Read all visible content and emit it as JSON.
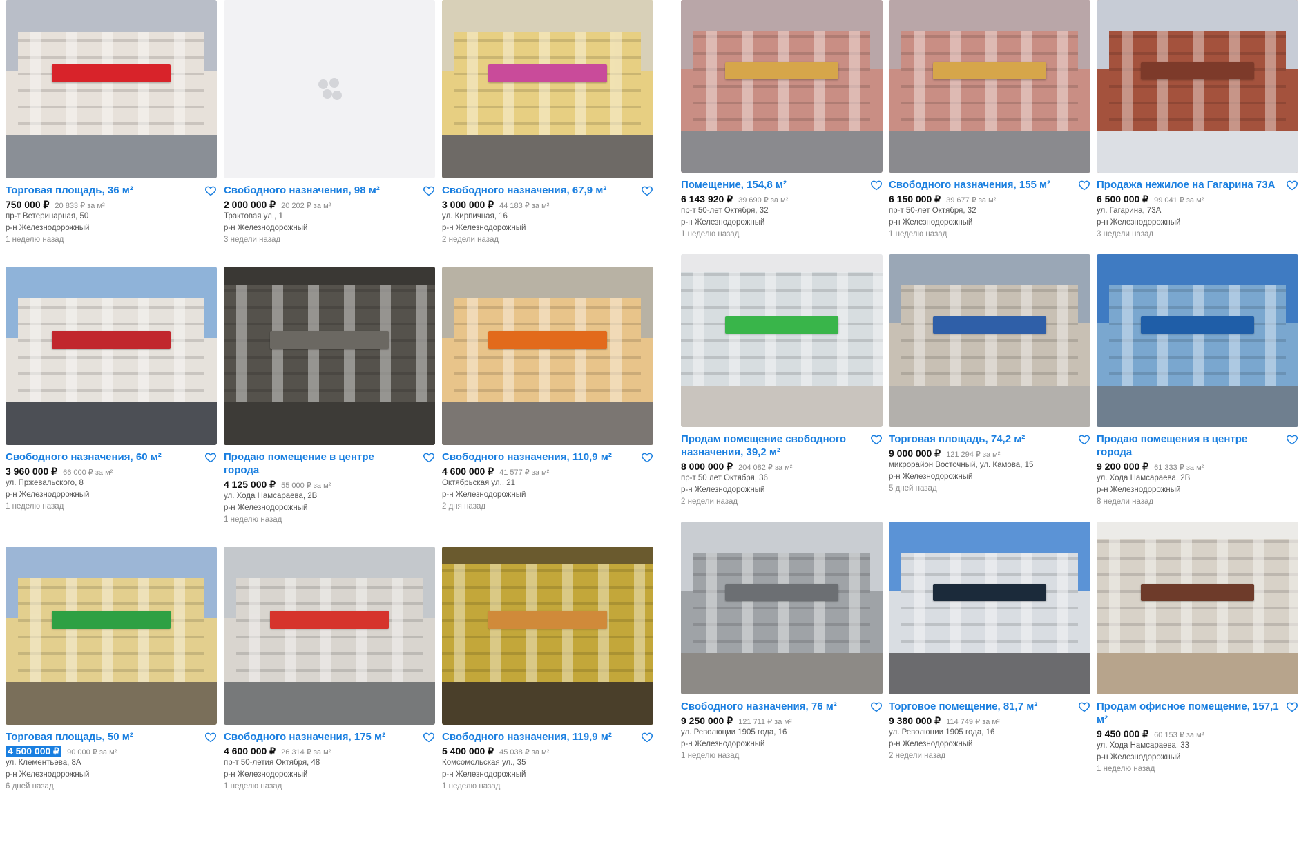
{
  "left": {
    "cards": [
      {
        "title": "Торговая площадь, 36 м²",
        "price": "750 000 ₽",
        "ppm": "20 833 ₽ за м²",
        "address": "пр-т Ветеринарная, 50",
        "district": "р-н Железнодорожный",
        "date": "1 неделю назад",
        "photo": {
          "type": "street",
          "sky": "#b9bec8",
          "wall": "#e7e1da",
          "sign": "#d8232a",
          "ground": "#8a8f96"
        }
      },
      {
        "title": "Свободного назначения, 98 м²",
        "price": "2 000 000 ₽",
        "ppm": "20 202 ₽ за м²",
        "address": "Трактовая ул., 1",
        "district": "р-н Железнодорожный",
        "date": "3 недели назад",
        "photo": {
          "type": "placeholder"
        }
      },
      {
        "title": "Свободного назначения, 67,9 м²",
        "price": "3 000 000 ₽",
        "ppm": "44 183 ₽ за м²",
        "address": "ул. Кирпичная, 16",
        "district": "р-н Железнодорожный",
        "date": "2 недели назад",
        "photo": {
          "type": "street",
          "sky": "#d8d0b8",
          "wall": "#e7cf82",
          "sign": "#c94b9a",
          "ground": "#6e6a66"
        }
      },
      {
        "title": "Свободного назначения, 60 м²",
        "price": "3 960 000 ₽",
        "ppm": "66 000 ₽ за м²",
        "address": "ул. Пржевальского, 8",
        "district": "р-н Железнодорожный",
        "date": "1 неделю назад",
        "photo": {
          "type": "street",
          "sky": "#8fb3d9",
          "wall": "#e6e2dc",
          "sign": "#c1272d",
          "ground": "#4c4f55"
        }
      },
      {
        "title": "Продаю помещение в центре города",
        "price": "4 125 000 ₽",
        "ppm": "55 000 ₽ за м²",
        "address": "ул. Хода Намсараева, 2В",
        "district": "р-н Железнодорожный",
        "date": "1 неделю назад",
        "photo": {
          "type": "interior",
          "sky": "#3a3834",
          "wall": "#55524c",
          "sign": "#6b6862",
          "ground": "#3d3b37"
        }
      },
      {
        "title": "Свободного назначения, 110,9 м²",
        "price": "4 600 000 ₽",
        "ppm": "41 577 ₽ за м²",
        "address": "Октябрьская ул., 21",
        "district": "р-н Железнодорожный",
        "date": "2 дня назад",
        "photo": {
          "type": "street",
          "sky": "#b8b2a4",
          "wall": "#e8c48a",
          "sign": "#e26a1b",
          "ground": "#7b7672"
        }
      },
      {
        "title": "Торговая площадь, 50 м²",
        "price": "4 500 000 ₽",
        "ppm": "90 000 ₽ за м²",
        "address": "ул. Клементьева, 8А",
        "district": "р-н Железнодорожный",
        "date": "6 дней назад",
        "highlight": true,
        "photo": {
          "type": "street",
          "sky": "#9cb6d6",
          "wall": "#e3cf8e",
          "sign": "#2ea043",
          "ground": "#7a6f5a"
        }
      },
      {
        "title": "Свободного назначения, 175 м²",
        "price": "4 600 000 ₽",
        "ppm": "26 314 ₽ за м²",
        "address": "пр-т 50-летия Октября, 48",
        "district": "р-н Железнодорожный",
        "date": "1 неделю назад",
        "photo": {
          "type": "street",
          "sky": "#c4c8cc",
          "wall": "#d9d5cf",
          "sign": "#d6342c",
          "ground": "#77797a"
        }
      },
      {
        "title": "Свободного назначения, 119,9 м²",
        "price": "5 400 000 ₽",
        "ppm": "45 038 ₽ за м²",
        "address": "Комсомольская ул., 35",
        "district": "р-н Железнодорожный",
        "date": "1 неделю назад",
        "photo": {
          "type": "interior",
          "sky": "#6a5a2e",
          "wall": "#c3a73a",
          "sign": "#d08a3a",
          "ground": "#4a3f2a"
        }
      }
    ]
  },
  "right": {
    "cards": [
      {
        "title": "Помещение, 154,8 м²",
        "price": "6 143 920 ₽",
        "ppm": "39 690 ₽ за м²",
        "address": "пр-т 50-лет Октября, 32",
        "district": "р-н Железнодорожный",
        "date": "1 неделю назад",
        "photo": {
          "type": "street",
          "sky": "#b9a6a8",
          "wall": "#c98e84",
          "sign": "#d6a64a",
          "ground": "#8a8a8e"
        }
      },
      {
        "title": "Свободного назначения, 155 м²",
        "price": "6 150 000 ₽",
        "ppm": "39 677 ₽ за м²",
        "address": "пр-т 50-лет Октября, 32",
        "district": "р-н Железнодорожный",
        "date": "1 неделю назад",
        "photo": {
          "type": "street",
          "sky": "#b9a6a8",
          "wall": "#c98e84",
          "sign": "#d6a64a",
          "ground": "#8a8a8e"
        }
      },
      {
        "title": "Продажа нежилое на Гагарина 73А",
        "price": "6 500 000 ₽",
        "ppm": "99 041 ₽ за м²",
        "address": "ул. Гагарина, 73А",
        "district": "р-н Железнодорожный",
        "date": "3 недели назад",
        "photo": {
          "type": "street",
          "sky": "#c7ccd6",
          "wall": "#a4523d",
          "sign": "#7d3a2a",
          "ground": "#dcdfe4"
        }
      },
      {
        "title": "Продам помещение свободного назначения, 39,2 м²",
        "price": "8 000 000 ₽",
        "ppm": "204 082 ₽ за м²",
        "address": "пр-т 50 лет Октября, 36",
        "district": "р-н Железнодорожный",
        "date": "2 недели назад",
        "photo": {
          "type": "interior",
          "sky": "#e8e8ea",
          "wall": "#d7dde0",
          "sign": "#39b54a",
          "ground": "#c9c4be"
        }
      },
      {
        "title": "Торговая площадь, 74,2 м²",
        "price": "9 000 000 ₽",
        "ppm": "121 294 ₽ за м²",
        "address": "микрорайон Восточный, ул. Камова, 15",
        "district": "р-н Железнодорожный",
        "date": "5 дней назад",
        "photo": {
          "type": "street",
          "sky": "#9aa7b6",
          "wall": "#c8c0b4",
          "sign": "#2f5fa8",
          "ground": "#b3b0ac"
        }
      },
      {
        "title": "Продаю помещения в центре города",
        "price": "9 200 000 ₽",
        "ppm": "61 333 ₽ за м²",
        "address": "ул. Хода Намсараева, 2В",
        "district": "р-н Железнодорожный",
        "date": "8 недели назад",
        "photo": {
          "type": "street",
          "sky": "#3f7bc2",
          "wall": "#7aa7cf",
          "sign": "#1f5ea8",
          "ground": "#6f7f8f"
        }
      },
      {
        "title": "Свободного назначения, 76 м²",
        "price": "9 250 000 ₽",
        "ppm": "121 711 ₽ за м²",
        "address": "ул. Революции 1905 года, 16",
        "district": "р-н Железнодорожный",
        "date": "1 неделю назад",
        "photo": {
          "type": "street",
          "sky": "#c9cdd2",
          "wall": "#9fa3a7",
          "sign": "#6c6f73",
          "ground": "#8d8a86"
        }
      },
      {
        "title": "Торговое помещение, 81,7 м²",
        "price": "9 380 000 ₽",
        "ppm": "114 749 ₽ за м²",
        "address": "ул. Революции 1905 года, 16",
        "district": "р-н Железнодорожный",
        "date": "2 недели назад",
        "photo": {
          "type": "street",
          "sky": "#5b93d6",
          "wall": "#d9dde2",
          "sign": "#1b2a3a",
          "ground": "#6b6b6e"
        }
      },
      {
        "title": "Продам офисное помещение, 157,1 м²",
        "price": "9 450 000 ₽",
        "ppm": "60 153 ₽ за м²",
        "address": "ул. Хода Намсараева, 33",
        "district": "р-н Железнодорожный",
        "date": "1 неделю назад",
        "photo": {
          "type": "interior",
          "sky": "#ecebe8",
          "wall": "#d8d2c8",
          "sign": "#6e3b2a",
          "ground": "#b7a48c"
        }
      }
    ]
  },
  "colors": {
    "link": "#1a7fe0",
    "price": "#111111",
    "muted": "#8a8a8a"
  },
  "icons": {
    "favorite": "heart-outline-icon"
  }
}
